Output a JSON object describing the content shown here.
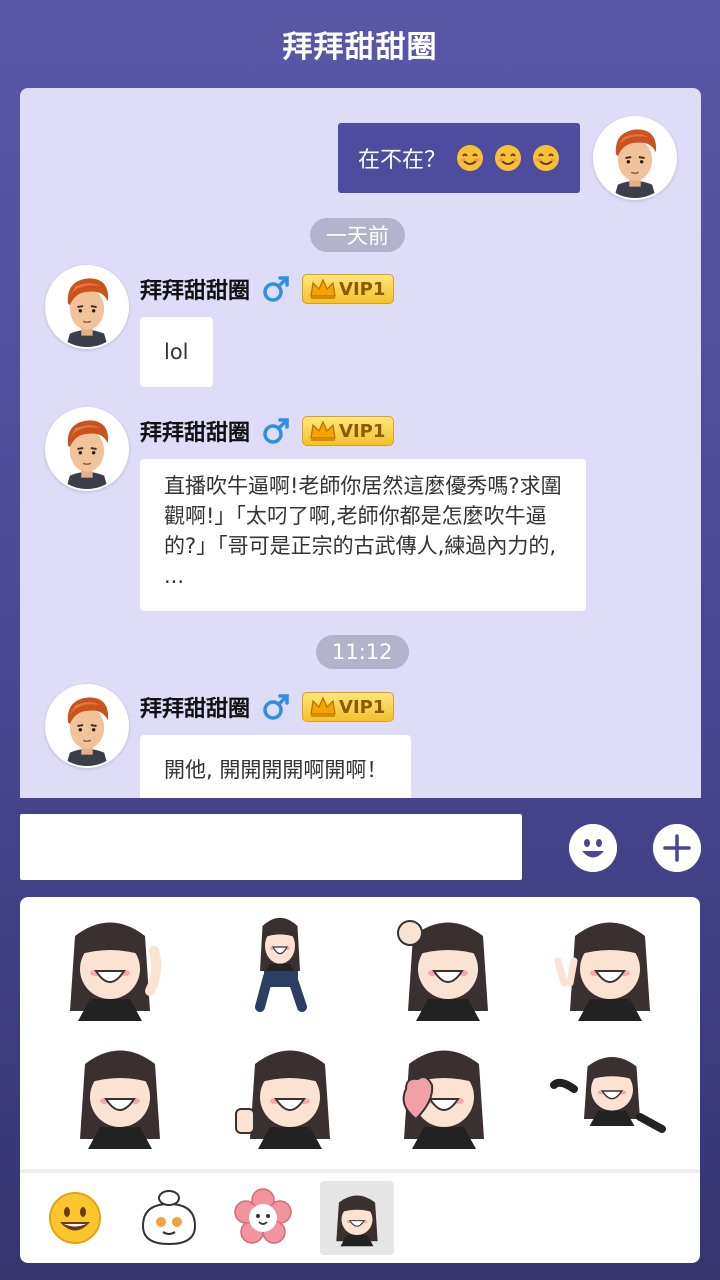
{
  "header": {
    "title": "拜拜甜甜圈"
  },
  "messages": {
    "mine": {
      "text": "在不在？"
    },
    "time_1": "一天前",
    "time_2": "11:12",
    "user_name": "拜拜甜甜圈",
    "vip_label": "VIP1",
    "msg_1": "lol",
    "msg_2": "直播吹牛逼啊!老師你居然這麼優秀嗎?求圍觀啊!」「太叼了啊,老師你都是怎麼吹牛逼的?」「哥可是正宗的古武傳人,練過內力的, ...",
    "msg_3": "開他, 開開開開啊開啊！"
  },
  "input": {
    "value": "",
    "placeholder": ""
  },
  "icons": {
    "emoji_button": "smiley-icon",
    "plus_button": "plus-icon",
    "gender": "male-icon",
    "vip": "crown-icon"
  },
  "sticker_pack": {
    "active_tab": 3,
    "tabs": [
      "smiley-emoji-pack",
      "chef-character-pack",
      "flower-character-pack",
      "girl-character-pack"
    ],
    "stickers": [
      "girl-wave-sticker",
      "girl-dance-sticker",
      "girl-ok-sticker",
      "girl-peace-sticker",
      "girl-grin-sticker",
      "girl-thumbs-up-sticker",
      "girl-heart-sticker",
      "girl-point-sticker"
    ]
  },
  "colors": {
    "header_bg": "#5a57a8",
    "chat_bg": "#dedcf6",
    "my_bubble": "#4d4c9e",
    "time_pill": "#b4b3cc",
    "vip_gold": "#f2c12e",
    "male_blue": "#2f8fe0"
  }
}
